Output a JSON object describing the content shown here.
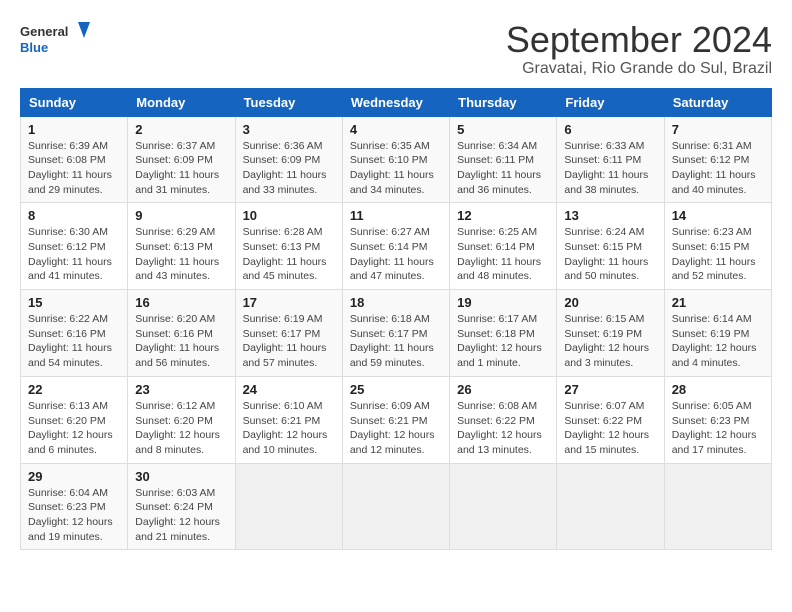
{
  "logo": {
    "line1": "General",
    "line2": "Blue"
  },
  "title": "September 2024",
  "subtitle": "Gravatai, Rio Grande do Sul, Brazil",
  "headers": [
    "Sunday",
    "Monday",
    "Tuesday",
    "Wednesday",
    "Thursday",
    "Friday",
    "Saturday"
  ],
  "weeks": [
    [
      {
        "day": "1",
        "info": "Sunrise: 6:39 AM\nSunset: 6:08 PM\nDaylight: 11 hours\nand 29 minutes."
      },
      {
        "day": "2",
        "info": "Sunrise: 6:37 AM\nSunset: 6:09 PM\nDaylight: 11 hours\nand 31 minutes."
      },
      {
        "day": "3",
        "info": "Sunrise: 6:36 AM\nSunset: 6:09 PM\nDaylight: 11 hours\nand 33 minutes."
      },
      {
        "day": "4",
        "info": "Sunrise: 6:35 AM\nSunset: 6:10 PM\nDaylight: 11 hours\nand 34 minutes."
      },
      {
        "day": "5",
        "info": "Sunrise: 6:34 AM\nSunset: 6:11 PM\nDaylight: 11 hours\nand 36 minutes."
      },
      {
        "day": "6",
        "info": "Sunrise: 6:33 AM\nSunset: 6:11 PM\nDaylight: 11 hours\nand 38 minutes."
      },
      {
        "day": "7",
        "info": "Sunrise: 6:31 AM\nSunset: 6:12 PM\nDaylight: 11 hours\nand 40 minutes."
      }
    ],
    [
      {
        "day": "8",
        "info": "Sunrise: 6:30 AM\nSunset: 6:12 PM\nDaylight: 11 hours\nand 41 minutes."
      },
      {
        "day": "9",
        "info": "Sunrise: 6:29 AM\nSunset: 6:13 PM\nDaylight: 11 hours\nand 43 minutes."
      },
      {
        "day": "10",
        "info": "Sunrise: 6:28 AM\nSunset: 6:13 PM\nDaylight: 11 hours\nand 45 minutes."
      },
      {
        "day": "11",
        "info": "Sunrise: 6:27 AM\nSunset: 6:14 PM\nDaylight: 11 hours\nand 47 minutes."
      },
      {
        "day": "12",
        "info": "Sunrise: 6:25 AM\nSunset: 6:14 PM\nDaylight: 11 hours\nand 48 minutes."
      },
      {
        "day": "13",
        "info": "Sunrise: 6:24 AM\nSunset: 6:15 PM\nDaylight: 11 hours\nand 50 minutes."
      },
      {
        "day": "14",
        "info": "Sunrise: 6:23 AM\nSunset: 6:15 PM\nDaylight: 11 hours\nand 52 minutes."
      }
    ],
    [
      {
        "day": "15",
        "info": "Sunrise: 6:22 AM\nSunset: 6:16 PM\nDaylight: 11 hours\nand 54 minutes."
      },
      {
        "day": "16",
        "info": "Sunrise: 6:20 AM\nSunset: 6:16 PM\nDaylight: 11 hours\nand 56 minutes."
      },
      {
        "day": "17",
        "info": "Sunrise: 6:19 AM\nSunset: 6:17 PM\nDaylight: 11 hours\nand 57 minutes."
      },
      {
        "day": "18",
        "info": "Sunrise: 6:18 AM\nSunset: 6:17 PM\nDaylight: 11 hours\nand 59 minutes."
      },
      {
        "day": "19",
        "info": "Sunrise: 6:17 AM\nSunset: 6:18 PM\nDaylight: 12 hours\nand 1 minute."
      },
      {
        "day": "20",
        "info": "Sunrise: 6:15 AM\nSunset: 6:19 PM\nDaylight: 12 hours\nand 3 minutes."
      },
      {
        "day": "21",
        "info": "Sunrise: 6:14 AM\nSunset: 6:19 PM\nDaylight: 12 hours\nand 4 minutes."
      }
    ],
    [
      {
        "day": "22",
        "info": "Sunrise: 6:13 AM\nSunset: 6:20 PM\nDaylight: 12 hours\nand 6 minutes."
      },
      {
        "day": "23",
        "info": "Sunrise: 6:12 AM\nSunset: 6:20 PM\nDaylight: 12 hours\nand 8 minutes."
      },
      {
        "day": "24",
        "info": "Sunrise: 6:10 AM\nSunset: 6:21 PM\nDaylight: 12 hours\nand 10 minutes."
      },
      {
        "day": "25",
        "info": "Sunrise: 6:09 AM\nSunset: 6:21 PM\nDaylight: 12 hours\nand 12 minutes."
      },
      {
        "day": "26",
        "info": "Sunrise: 6:08 AM\nSunset: 6:22 PM\nDaylight: 12 hours\nand 13 minutes."
      },
      {
        "day": "27",
        "info": "Sunrise: 6:07 AM\nSunset: 6:22 PM\nDaylight: 12 hours\nand 15 minutes."
      },
      {
        "day": "28",
        "info": "Sunrise: 6:05 AM\nSunset: 6:23 PM\nDaylight: 12 hours\nand 17 minutes."
      }
    ],
    [
      {
        "day": "29",
        "info": "Sunrise: 6:04 AM\nSunset: 6:23 PM\nDaylight: 12 hours\nand 19 minutes."
      },
      {
        "day": "30",
        "info": "Sunrise: 6:03 AM\nSunset: 6:24 PM\nDaylight: 12 hours\nand 21 minutes."
      },
      null,
      null,
      null,
      null,
      null
    ]
  ]
}
